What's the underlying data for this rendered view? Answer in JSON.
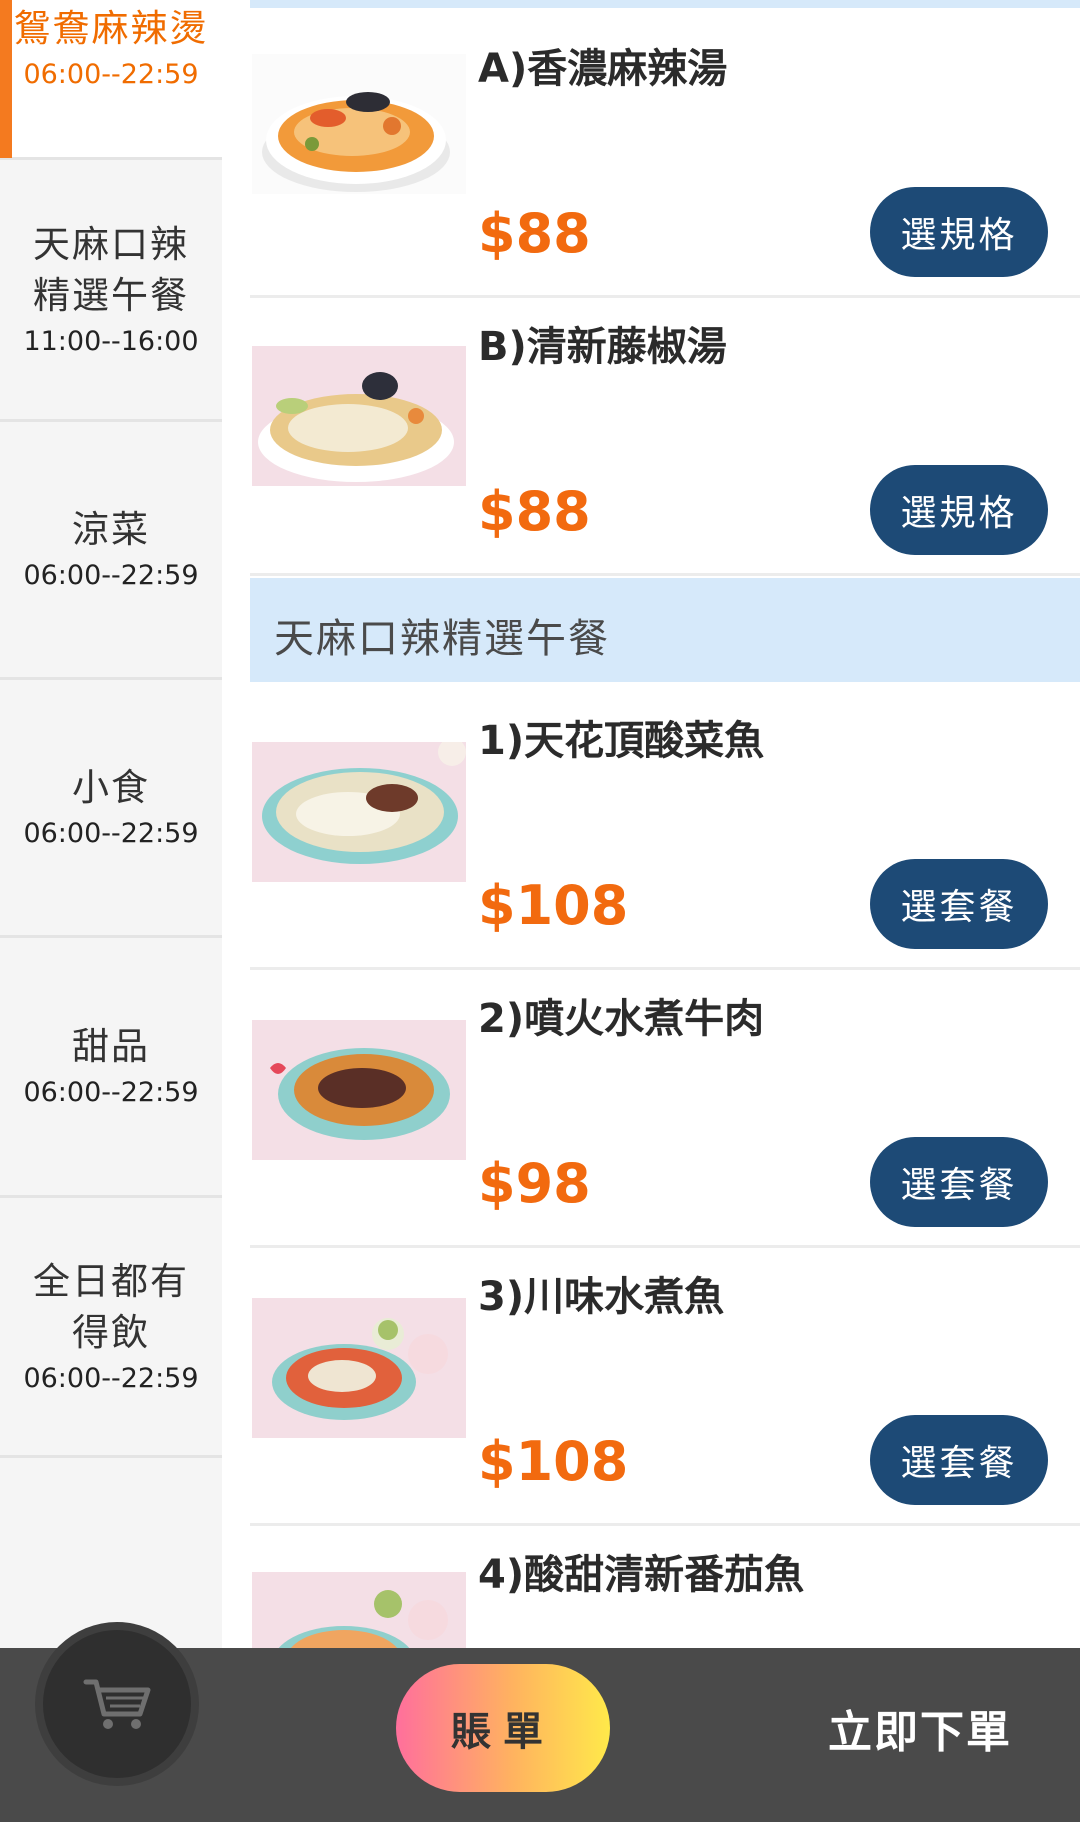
{
  "sidebar": {
    "categories": [
      {
        "name": "鴛鴦麻辣燙",
        "time": "06:00--22:59",
        "active": true
      },
      {
        "name": "天麻口辣精選午餐",
        "time": "11:00--16:00",
        "active": false
      },
      {
        "name": "涼菜",
        "time": "06:00--22:59",
        "active": false
      },
      {
        "name": "小食",
        "time": "06:00--22:59",
        "active": false
      },
      {
        "name": "甜品",
        "time": "06:00--22:59",
        "active": false
      },
      {
        "name": "全日都有得飲",
        "time": "06:00--22:59",
        "active": false
      }
    ]
  },
  "menu": {
    "soup_items": [
      {
        "name": "A)香濃麻辣湯",
        "price": "$88",
        "button": "選規格"
      },
      {
        "name": "B)清新藤椒湯",
        "price": "$88",
        "button": "選規格"
      }
    ],
    "section_title": "天麻口辣精選午餐",
    "lunch_items": [
      {
        "name": "1)天花頂酸菜魚",
        "price": "$108",
        "button": "選套餐"
      },
      {
        "name": "2)噴火水煮牛肉",
        "price": "$98",
        "button": "選套餐"
      },
      {
        "name": "3)川味水煮魚",
        "price": "$108",
        "button": "選套餐"
      },
      {
        "name": "4)酸甜清新番茄魚"
      }
    ]
  },
  "bottom_bar": {
    "bill_label": "賬單",
    "order_label": "立即下單",
    "cart_icon": "shopping-cart-icon"
  },
  "colors": {
    "accent_orange": "#f26a0f",
    "button_navy": "#1d4a76",
    "section_blue": "#d6e9fa",
    "bottom_bar": "#4a4a4a"
  }
}
